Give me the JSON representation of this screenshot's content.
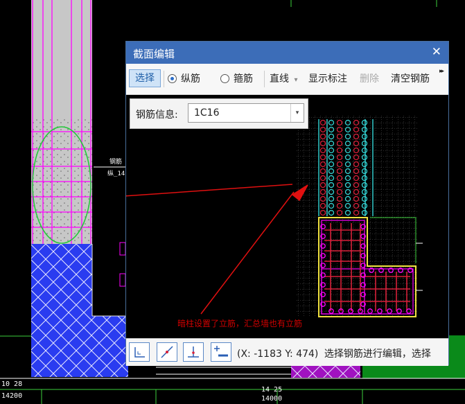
{
  "dialog": {
    "title": "截面编辑",
    "close_glyph": "✕",
    "toolbar": {
      "select_label": "选择",
      "longitudinal_label": "纵筋",
      "stirrup_label": "箍筋",
      "line_label": "直线",
      "line_dropdown_glyph": "▾",
      "show_annotation_label": "显示标注",
      "delete_label": "删除",
      "clear_rebar_label": "清空钢筋",
      "overflow_glyph": "▸▸"
    },
    "rebar_info": {
      "label": "钢筋信息:",
      "value": "1C16",
      "arrow_glyph": "▾"
    },
    "annotation_text": "暗柱设置了立筋，汇总墙也有立筋",
    "status": {
      "coords": "(X: -1183 Y: 474)",
      "message": "选择钢筋进行编辑，选择"
    },
    "status_buttons": [
      "orthogonal-icon",
      "oblique-icon",
      "vertical-icon",
      "add-rebar-icon"
    ]
  },
  "cad_labels": {
    "left_small_1": "钢筋",
    "left_small_2": "纵_14",
    "bottom_left_1": "10 28",
    "bottom_left_2": "14200",
    "bottom_mid_1": "14 25",
    "bottom_mid_2": "14000"
  },
  "colors": {
    "titlebar": "#3c6db8",
    "annotation": "#d00000",
    "wall_fill": "#2a3cf0",
    "rebar_magenta": "#ff00ff",
    "rebar_red": "#d8203a",
    "rebar_cyan": "#33d6d6",
    "outline_yellow": "#f0e040",
    "ellipse_green": "#21c838",
    "arrow_red": "#e01010"
  }
}
